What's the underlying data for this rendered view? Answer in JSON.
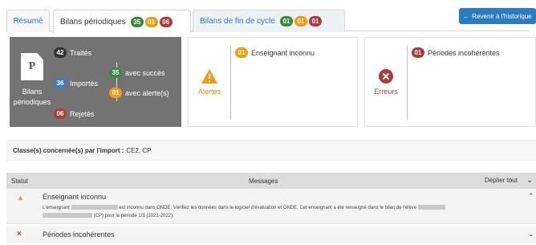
{
  "tabs": {
    "resume": "Résumé",
    "bilans": {
      "label": "Bilans périodiques",
      "badges": [
        "35",
        "01",
        "06"
      ]
    },
    "fin_cycle": {
      "label": "Bilans de fin de cycle",
      "badges": [
        "01",
        "01",
        "01"
      ]
    }
  },
  "retour_button": "Revenir à l'historique",
  "summary": {
    "doc_letter": "P",
    "doc_label": "Bilans périodiques",
    "traites": {
      "count": "42",
      "label": "Traités"
    },
    "importes": {
      "count": "36",
      "label": "Importés"
    },
    "rejetes": {
      "count": "06",
      "label": "Rejetés"
    },
    "succes": {
      "count": "35",
      "label": "avec succès"
    },
    "alerte": {
      "count": "01",
      "label": "avec alerte(s)"
    }
  },
  "alertes_panel": {
    "label": "Alertes",
    "count": "01",
    "message": "Enseignant inconnu"
  },
  "erreurs_panel": {
    "label": "Erreurs",
    "count": "01",
    "message": "Périodes incohérentes"
  },
  "classes": {
    "label": "Classe(s) concernée(s) par l'import :",
    "value": "CE2, CP"
  },
  "table": {
    "col_statut": "Statut",
    "col_messages": "Messages",
    "deplier": "Déplier tout",
    "rows": [
      {
        "title": "Enseignant inconnu",
        "line1_a": "L'enseignant",
        "line1_b": "est inconnu dans ONDE. Vérifiez les données dans le logiciel d'évaluation et ONDE. Cet enseignant a été renseigné dans le bilan de l'élève",
        "line2": "(CP) pour la période 1/3 (2021-2022)."
      },
      {
        "title": "Périodes incohérentes"
      }
    ]
  },
  "colors": {
    "accent": "#2a7bc0",
    "green": "#3a8a3a",
    "orange": "#f39c12",
    "red": "#b03a3a",
    "panel": "#737373"
  }
}
